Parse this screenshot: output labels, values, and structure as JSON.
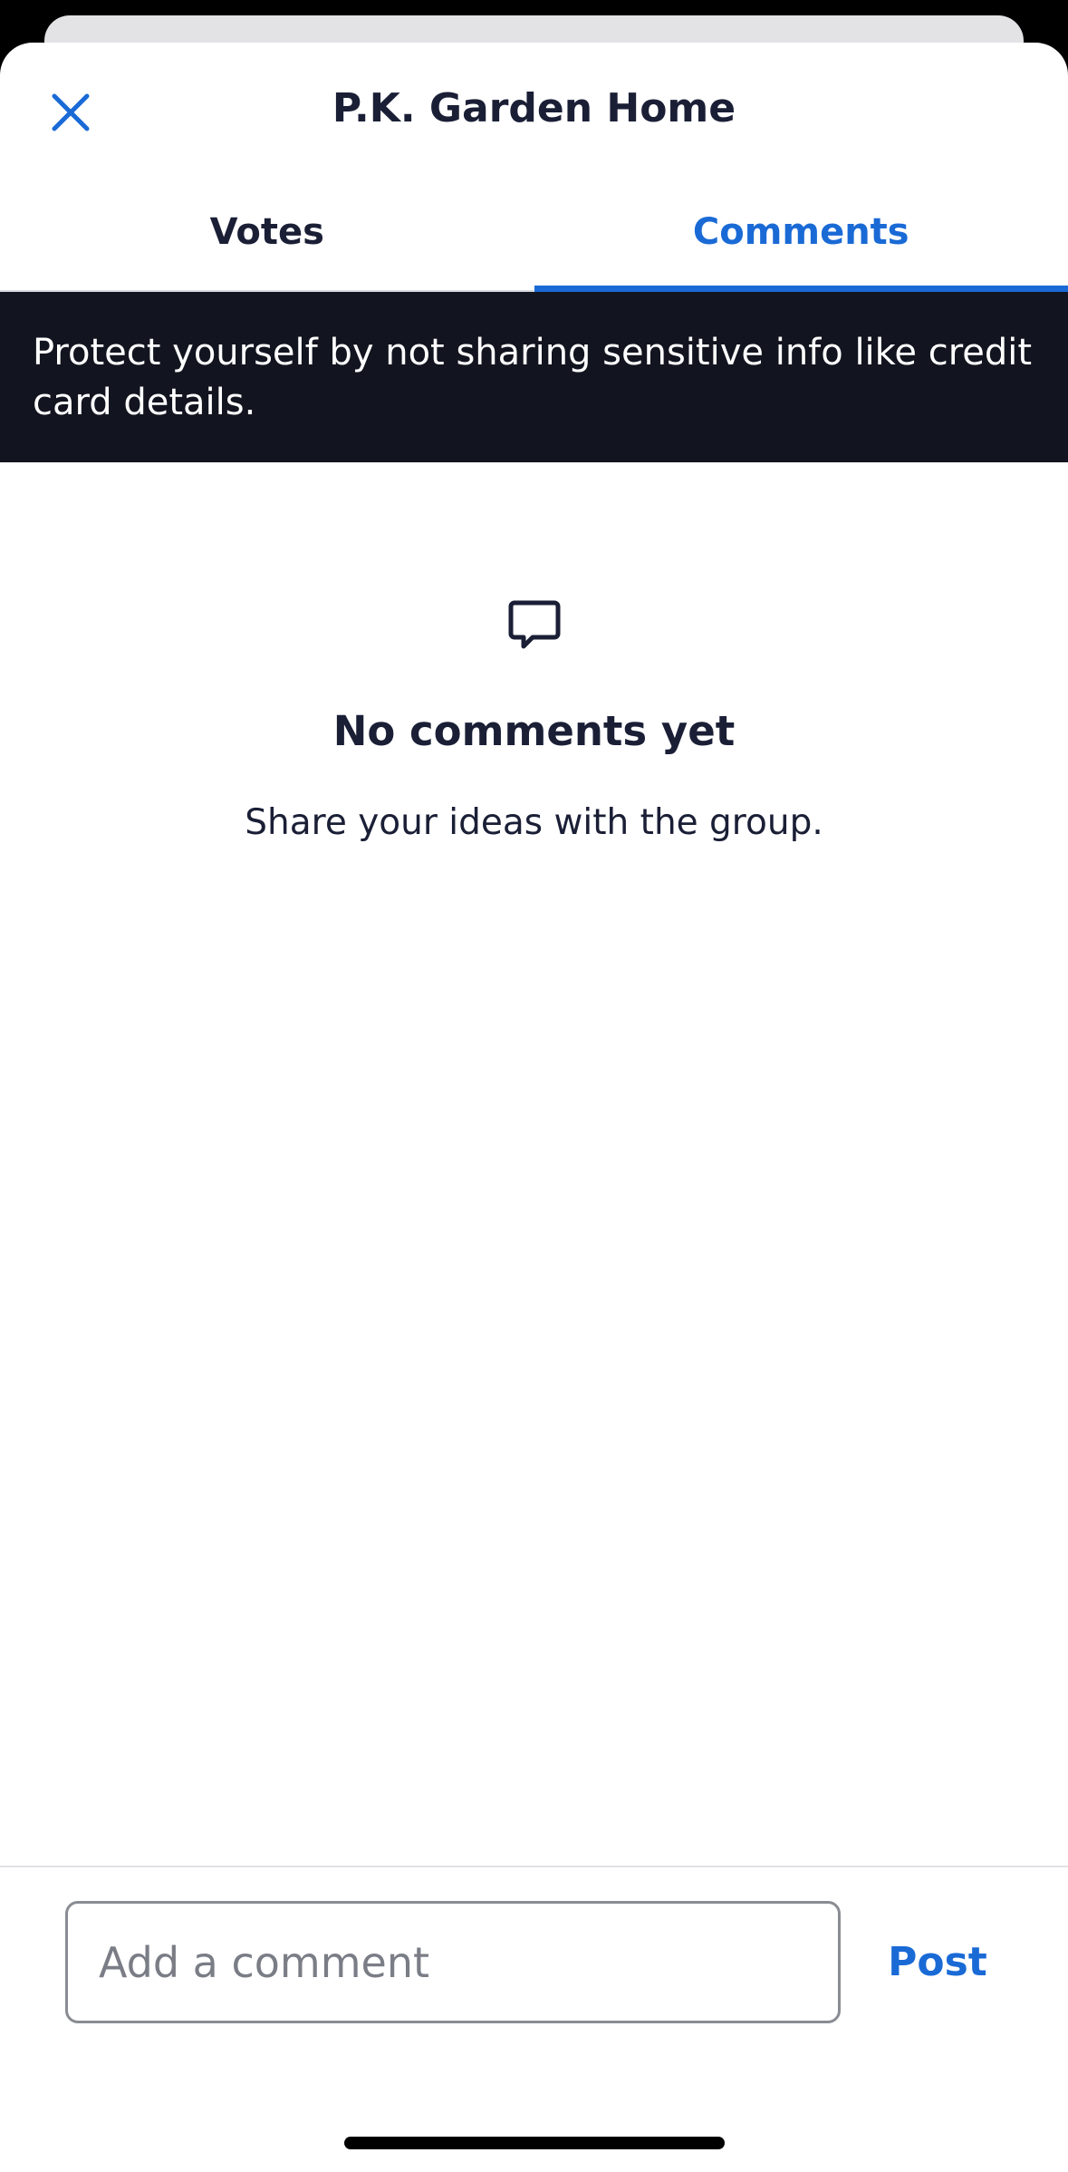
{
  "header": {
    "title": "P.K. Garden Home",
    "close_icon": "close-icon"
  },
  "tabs": [
    {
      "label": "Votes",
      "active": false
    },
    {
      "label": "Comments",
      "active": true
    }
  ],
  "banner": {
    "text": "Protect yourself by not sharing sensitive info like credit card details."
  },
  "empty_state": {
    "icon": "comment-bubble-icon",
    "title": "No comments yet",
    "subtitle": "Share your ideas with the group."
  },
  "composer": {
    "placeholder": "Add a comment",
    "value": "",
    "post_label": "Post"
  },
  "colors": {
    "accent": "#1a6ad6",
    "text": "#1a1f36",
    "banner_bg": "#12151f"
  }
}
